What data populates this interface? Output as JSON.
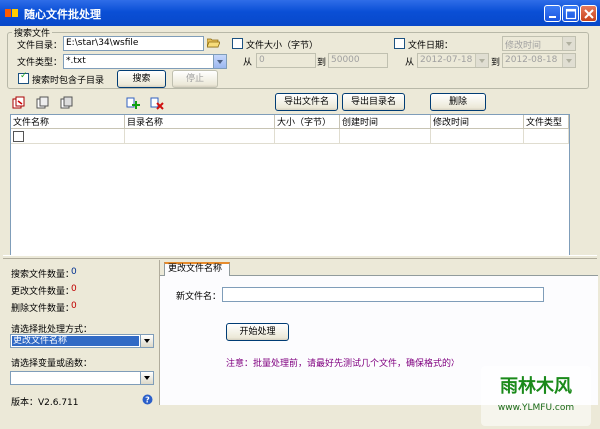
{
  "window": {
    "title": "随心文件批处理"
  },
  "search_group": {
    "legend": "搜索文件",
    "dir_label": "文件目录：",
    "dir_value": "E:\\star\\34\\wsfile",
    "type_label": "文件类型：",
    "type_value": "*.txt",
    "include_subdirs_label": "搜索时包含子目录",
    "include_subdirs_checked": true,
    "search_button": "搜索",
    "stop_button": "停止",
    "size_filter": {
      "label": "文件大小（字节）",
      "checked": false,
      "from_label": "从",
      "from_value": "0",
      "to_label": "到",
      "to_value": "50000"
    },
    "date_filter": {
      "label": "文件日期：",
      "checked": false,
      "kind_value": "修改时间",
      "from_label": "从",
      "from_value": "2012-07-18",
      "to_label": "到",
      "to_value": "2012-08-18"
    }
  },
  "toolbar": {
    "export_names": "导出文件名",
    "export_dirs": "导出目录名",
    "delete": "删除"
  },
  "file_grid": {
    "columns": [
      "文件名称",
      "目录名称",
      "大小（字节）",
      "创建时间",
      "修改时间",
      "文件类型"
    ]
  },
  "left_panel": {
    "searched_label": "搜索文件数量：",
    "searched_value": "0",
    "renamed_label": "更改文件数量：",
    "renamed_value": "0",
    "deleted_label": "删除文件数量：",
    "deleted_value": "0",
    "method_label": "请选择批处理方式：",
    "method_value": "更改文件名称",
    "variable_label": "请选择变量或函数：",
    "variable_value": "",
    "version_text": "版本：V2.6.711"
  },
  "rename_tab": {
    "tab_label": "更改文件名称",
    "new_name_label": "新文件名：",
    "new_name_value": "",
    "start_button": "开始处理",
    "notice": "注意：批量处理前，请最好先测试几个文件，确保格式的准确"
  },
  "watermark": {
    "text": "雨林木风",
    "url": "www.YLMFU.com"
  },
  "colors": {
    "titlebar": "#0a4fd6",
    "count_red": "#c00000",
    "count_blue": "#003090",
    "notice": "#800080",
    "selection": "#316ac5"
  }
}
